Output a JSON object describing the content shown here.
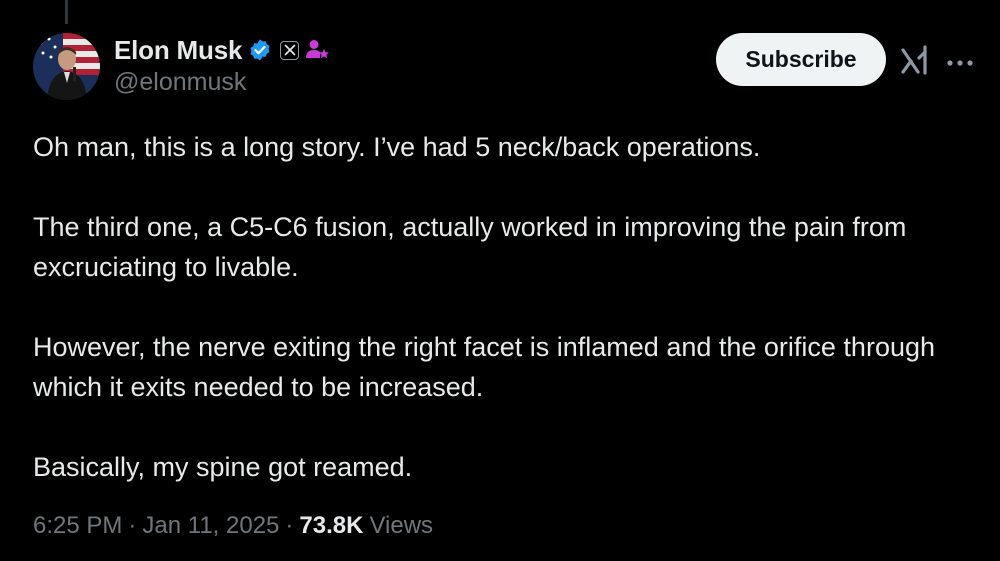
{
  "author": {
    "display_name": "Elon Musk",
    "handle": "@elonmusk",
    "verified_badge_color": "#1d9bf0",
    "affiliate_badge_color": "#c93bd6"
  },
  "actions": {
    "subscribe_label": "Subscribe",
    "grok_icon": "grok-icon",
    "more_icon": "more-icon"
  },
  "tweet": {
    "paragraphs": [
      "Oh man, this is a long story. I’ve had 5 neck/back operations.",
      "The third one, a C5-C6 fusion, actually worked in improving the pain from excruciating to livable.",
      "However, the nerve exiting the right facet is inflamed and the orifice through which it exits needed to be increased.",
      "Basically, my spine got reamed."
    ]
  },
  "meta": {
    "time": "6:25 PM",
    "separator": "·",
    "date": "Jan 11, 2025",
    "views_count": "73.8K",
    "views_label": "Views"
  },
  "colors": {
    "background": "#000000",
    "text_primary": "#e7e9ea",
    "text_secondary": "#71767b",
    "button_bg": "#eff3f4"
  }
}
